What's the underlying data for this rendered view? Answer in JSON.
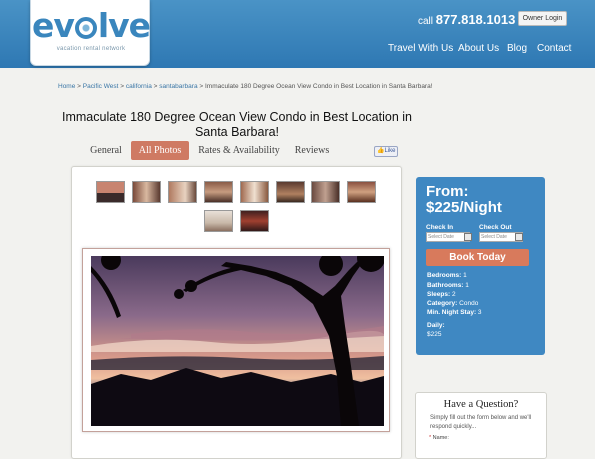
{
  "header": {
    "logo_text": "evolve",
    "logo_tagline": "vacation rental network",
    "phone_prefix": "call",
    "phone_number": "877.818.1013",
    "owner_login": "Owner Login",
    "nav": [
      "Travel With Us",
      "About Us",
      "Blog",
      "Contact"
    ]
  },
  "breadcrumb": {
    "items": [
      "Home",
      "Pacific West",
      "california",
      "santabarbara",
      "Immaculate 180 Degree Ocean View Condo in Best Location in Santa Barbara!"
    ],
    "separator": ">"
  },
  "listing": {
    "title": "Immaculate 180 Degree Ocean View Condo in Best Location in Santa Barbara!"
  },
  "tabs": [
    {
      "label": "General",
      "active": false
    },
    {
      "label": "All Photos",
      "active": true
    },
    {
      "label": "Rates & Availability",
      "active": false
    },
    {
      "label": "Reviews",
      "active": false
    }
  ],
  "fb_like": "Like",
  "booking": {
    "from_label": "From:",
    "price": "$225/Night",
    "check_in_label": "Check In",
    "check_out_label": "Check Out",
    "date_placeholder": "Select Date",
    "book_button": "Book Today",
    "details": [
      {
        "label": "Bedrooms:",
        "value": "1"
      },
      {
        "label": "Bathrooms:",
        "value": "1"
      },
      {
        "label": "Sleeps:",
        "value": "2"
      },
      {
        "label": "Category:",
        "value": "Condo"
      },
      {
        "label": "Min. Night Stay:",
        "value": "3"
      }
    ],
    "daily_label": "Daily:",
    "daily_value": "$225"
  },
  "question": {
    "title": "Have a Question?",
    "text": "Simply fill out the form below and we'll respond quickly...",
    "name_required": "*",
    "name_label": "Name:"
  },
  "colors": {
    "header_blue": "#3a86bd",
    "accent_orange": "#d87a5c",
    "panel_blue": "#3f88c2"
  }
}
